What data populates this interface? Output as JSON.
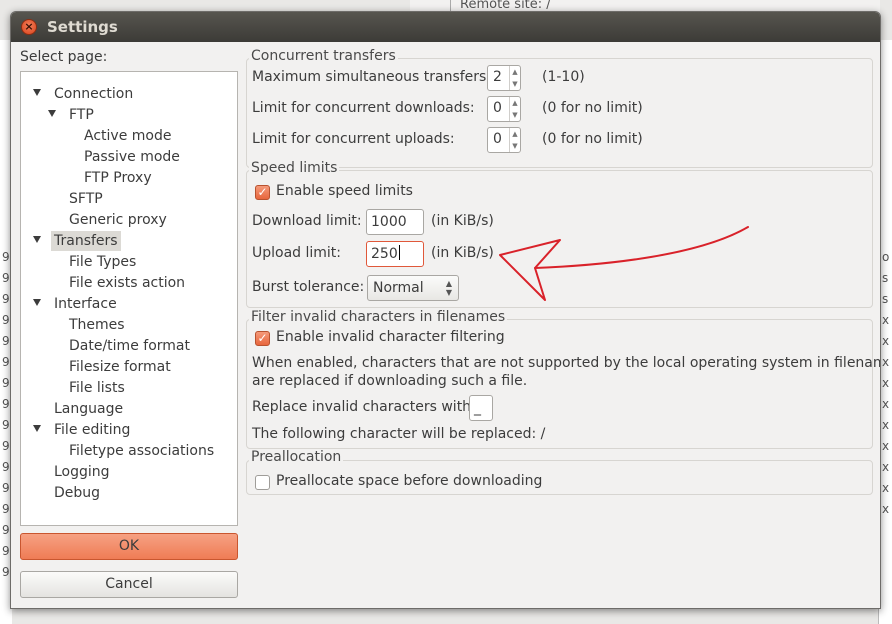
{
  "background": {
    "remote_site_label": "Remote site: /",
    "left_digits": [
      "9",
      "9",
      "9",
      "9",
      "9",
      "9",
      "9",
      "9",
      "9",
      "9",
      "9",
      "9",
      "9",
      "9",
      "9",
      "9"
    ],
    "right_digits": [
      "o",
      "s",
      "s",
      "x",
      "x",
      "x",
      "x",
      "x",
      "x",
      "x",
      "x",
      "x",
      "x"
    ]
  },
  "window": {
    "title": "Settings",
    "close_icon": "close-icon"
  },
  "sidebar": {
    "select_page_label": "Select page:",
    "items": [
      {
        "label": "Connection",
        "expanded": true
      },
      {
        "label": "FTP",
        "expanded": true
      },
      {
        "label": "Active mode"
      },
      {
        "label": "Passive mode"
      },
      {
        "label": "FTP Proxy"
      },
      {
        "label": "SFTP"
      },
      {
        "label": "Generic proxy"
      },
      {
        "label": "Transfers",
        "expanded": true,
        "selected": true
      },
      {
        "label": "File Types"
      },
      {
        "label": "File exists action"
      },
      {
        "label": "Interface",
        "expanded": true
      },
      {
        "label": "Themes"
      },
      {
        "label": "Date/time format"
      },
      {
        "label": "Filesize format"
      },
      {
        "label": "File lists"
      },
      {
        "label": "Language"
      },
      {
        "label": "File editing",
        "expanded": true
      },
      {
        "label": "Filetype associations"
      },
      {
        "label": "Logging"
      },
      {
        "label": "Debug"
      }
    ],
    "ok_label": "OK",
    "cancel_label": "Cancel"
  },
  "concurrent": {
    "title": "Concurrent transfers",
    "max_label": "Maximum simultaneous transfers:",
    "max_value": "2",
    "max_hint": "(1-10)",
    "downloads_label": "Limit for concurrent downloads:",
    "downloads_value": "0",
    "downloads_hint": "(0 for no limit)",
    "uploads_label": "Limit for concurrent uploads:",
    "uploads_value": "0",
    "uploads_hint": "(0 for no limit)"
  },
  "speed": {
    "title": "Speed limits",
    "enable_label": "Enable speed limits",
    "enable_checked": true,
    "download_label": "Download limit:",
    "download_value": "1000",
    "download_unit": "(in KiB/s)",
    "upload_label": "Upload limit:",
    "upload_value": "250",
    "upload_unit": "(in KiB/s)",
    "burst_label": "Burst tolerance:",
    "burst_value": "Normal"
  },
  "filter": {
    "title": "Filter invalid characters in filenames",
    "enable_label": "Enable invalid character filtering",
    "enable_checked": true,
    "desc_line1": "When enabled, characters that are not supported by the local operating system in filenames",
    "desc_line2": "are replaced if downloading such a file.",
    "replace_label": "Replace invalid characters with:",
    "replace_value": "_",
    "following_label": "The following character will be replaced: /"
  },
  "prealloc": {
    "title": "Preallocation",
    "checkbox_label": "Preallocate space before downloading",
    "checked": false
  },
  "colors": {
    "accent": "#ef7c55",
    "annotation_arrow": "#d9222a"
  }
}
